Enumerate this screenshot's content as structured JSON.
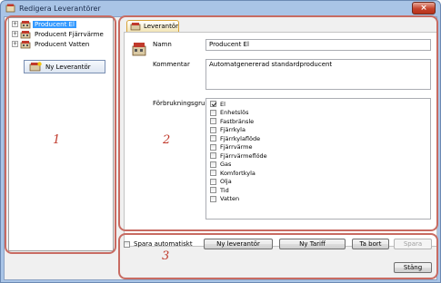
{
  "window": {
    "title": "Redigera Leverantörer",
    "close_glyph": "×"
  },
  "tree": {
    "items": [
      {
        "label": "Producent El",
        "expander": "+",
        "selected": true
      },
      {
        "label": "Producent Fjärrvärme",
        "expander": "+",
        "selected": false
      },
      {
        "label": "Producent Vatten",
        "expander": "+",
        "selected": false
      }
    ],
    "new_button": "Ny Leverantör"
  },
  "annotations": {
    "one": "1",
    "two": "2",
    "three": "3"
  },
  "tab": {
    "label": "Leverantör"
  },
  "form": {
    "name_label": "Namn",
    "name_value": "Producent El",
    "comment_label": "Kommentar",
    "comment_value": "Automatgenererad standardproducent",
    "group_label": "Förbrukningsgrup"
  },
  "groups": [
    {
      "label": "El",
      "checked": true
    },
    {
      "label": "Enhetslös",
      "checked": false
    },
    {
      "label": "Fastbränsle",
      "checked": false
    },
    {
      "label": "Fjärrkyla",
      "checked": false
    },
    {
      "label": "Fjärrkylaflöde",
      "checked": false
    },
    {
      "label": "Fjärrvärme",
      "checked": false
    },
    {
      "label": "Fjärrvärmeflöde",
      "checked": false
    },
    {
      "label": "Gas",
      "checked": false
    },
    {
      "label": "Komfortkyla",
      "checked": false
    },
    {
      "label": "Olja",
      "checked": false
    },
    {
      "label": "Tid",
      "checked": false
    },
    {
      "label": "Vatten",
      "checked": false
    }
  ],
  "bottom": {
    "autosave_label": "Spara automatiskt",
    "new_supplier": "Ny leverantör",
    "new_tariff": "Ny Tariff",
    "delete": "Ta bort",
    "save": "Spara",
    "close": "Stäng"
  }
}
